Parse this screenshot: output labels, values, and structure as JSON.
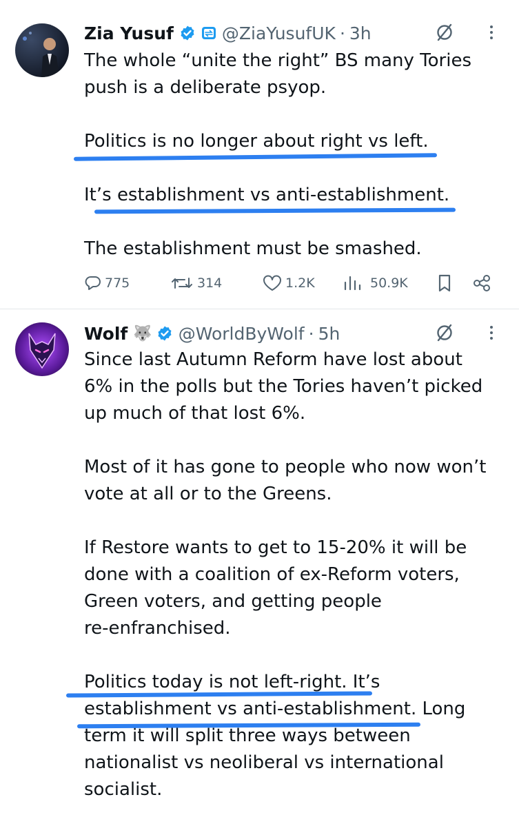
{
  "tweets": [
    {
      "author": "Zia Yusuf",
      "handle": "@ZiaYusufUK",
      "separator": "·",
      "time": "3h",
      "lines": [
        "The whole “unite the right” BS many Tories",
        "push is a deliberate psyop.",
        "Politics is no longer about right vs left.",
        "It’s establishment vs anti-establishment.",
        "The establishment must be smashed."
      ],
      "stats": {
        "replies": "775",
        "reposts": "314",
        "likes": "1.2K",
        "views": "50.9K"
      }
    },
    {
      "author": "Wolf",
      "emoji": "🐺",
      "handle": "@WorldByWolf",
      "separator": "·",
      "time": "5h",
      "lines": [
        "Since last Autumn Reform have lost about",
        "6% in the polls but the Tories haven’t picked",
        "up much of that lost 6%.",
        "Most of it has gone to people who now won’t",
        "vote at all or to the Greens.",
        "If Restore wants to get to 15-20% it will be",
        "done with a coalition of ex-Reform voters,",
        "Green voters, and getting people",
        "re-enfranchised.",
        "Politics today is not left-right. It’s",
        "establishment vs anti-establishment. Long",
        "term it will split three ways between",
        "nationalist vs neoliberal vs international",
        "socialist."
      ]
    }
  ],
  "colors": {
    "underline": "#2d7ff0",
    "verified": "#1d9bf0",
    "secondary_text": "#536471"
  },
  "icons": [
    "verified-badge-icon",
    "affiliate-badge-icon",
    "grok-icon",
    "more-icon",
    "reply-icon",
    "repost-icon",
    "like-icon",
    "views-icon",
    "bookmark-icon",
    "share-icon"
  ]
}
